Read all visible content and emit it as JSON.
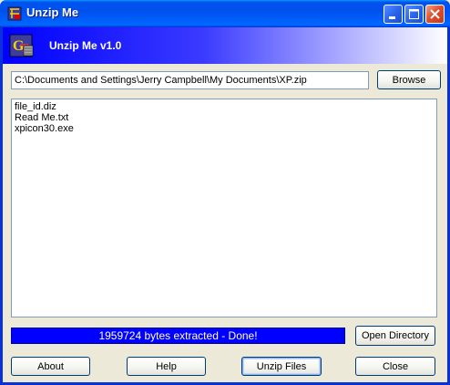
{
  "window": {
    "title": "Unzip Me"
  },
  "header": {
    "title": "Unzip Me v1.0"
  },
  "path": {
    "value": "C:\\Documents and Settings\\Jerry Campbell\\My Documents\\XP.zip"
  },
  "buttons": {
    "browse": "Browse",
    "open_directory": "Open Directory",
    "about": "About",
    "help": "Help",
    "unzip_files": "Unzip Files",
    "close": "Close"
  },
  "files": [
    "file_id.diz",
    "Read Me.txt",
    "xpicon30.exe"
  ],
  "status": {
    "text": "1959724 bytes extracted - Done!"
  },
  "colors": {
    "titlebar": "#0054e3",
    "header_gradient_start": "#0000ff",
    "status_bg": "#0000ff",
    "window_bg": "#ece9d8"
  },
  "icons": {
    "title_icon": "app-icon",
    "header_logo": "app-logo-icon",
    "minimize": "minimize-icon",
    "maximize": "maximize-icon",
    "close": "close-icon"
  }
}
